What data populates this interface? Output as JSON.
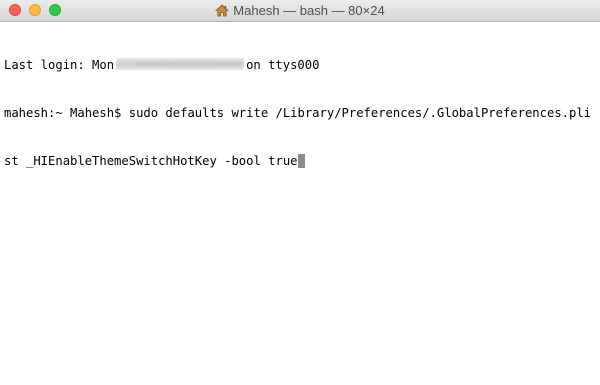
{
  "window": {
    "title": "Mahesh — bash — 80×24",
    "title_icon": "home-icon"
  },
  "terminal": {
    "login_prefix": "Last login: Mon",
    "login_suffix": "on ttys000",
    "prompt": "mahesh:~ Mahesh$ ",
    "command_line1": "sudo defaults write /Library/Preferences/.GlobalPreferences.pli",
    "command_line2": "st _HIEnableThemeSwitchHotKey -bool true"
  },
  "colors": {
    "close": "#fc605c",
    "minimize": "#fdbc40",
    "zoom": "#34c84a",
    "cursor": "#8c8c8c"
  }
}
